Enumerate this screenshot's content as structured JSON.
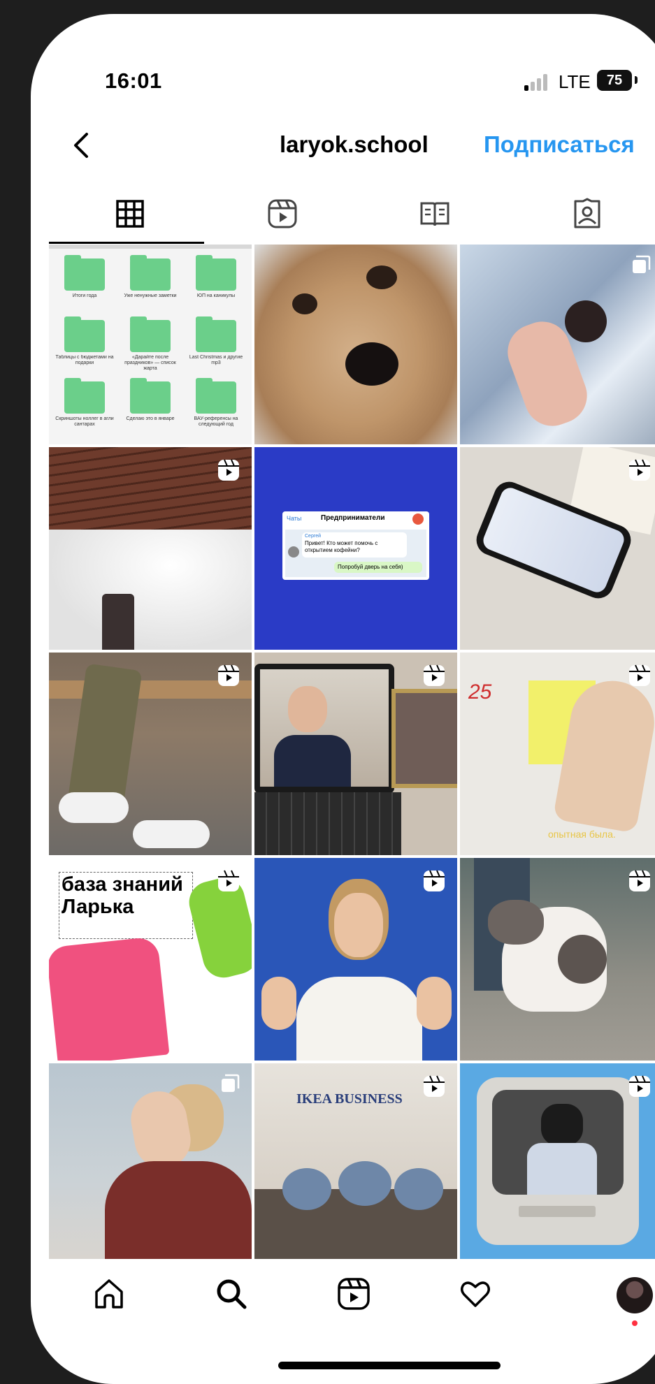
{
  "status_bar": {
    "time": "16:01",
    "network": "LTE",
    "battery": "75"
  },
  "header": {
    "username": "laryok.school",
    "follow_label": "Подписаться"
  },
  "tabs": [
    {
      "name": "grid",
      "icon": "grid-icon",
      "active": true
    },
    {
      "name": "reels",
      "icon": "reels-icon",
      "active": false
    },
    {
      "name": "guides",
      "icon": "guide-book-icon",
      "active": false
    },
    {
      "name": "tagged",
      "icon": "tagged-person-icon",
      "active": false
    }
  ],
  "posts": [
    {
      "id": 1,
      "badge": "none",
      "folders": [
        "Итоги года",
        "Уже ненужные заметки",
        "ЮП на каникулы",
        "Таблицы с бюджетами на подарки",
        "«Дарайте после праздников» — список жарта",
        "Last Christmas и другие mp3",
        "Скриншоты ноллег в агли сантарах",
        "Сделаю это в январе",
        "ВАУ-референсы на следующий год"
      ]
    },
    {
      "id": 2,
      "badge": "none"
    },
    {
      "id": 3,
      "badge": "multi"
    },
    {
      "id": 4,
      "badge": "reel"
    },
    {
      "id": 5,
      "badge": "none",
      "chat": {
        "back": "Чаты",
        "title": "Предприниматели",
        "sender": "Сергей",
        "message": "Привет! Кто может помочь с открытием кофейни?",
        "reply": "Попробуй дверь на себя)"
      }
    },
    {
      "id": 6,
      "badge": "reel"
    },
    {
      "id": 7,
      "badge": "reel"
    },
    {
      "id": 8,
      "badge": "reel"
    },
    {
      "id": 9,
      "badge": "reel",
      "caption": "опытная была.",
      "note_text": "25"
    },
    {
      "id": 10,
      "badge": "reel",
      "title": "база знаний Ларька"
    },
    {
      "id": 11,
      "badge": "reel"
    },
    {
      "id": 12,
      "badge": "reel"
    },
    {
      "id": 13,
      "badge": "multi"
    },
    {
      "id": 14,
      "badge": "reel",
      "sign": "IKEA BUSINESS"
    },
    {
      "id": 15,
      "badge": "reel"
    }
  ],
  "bottom_nav": [
    {
      "name": "home",
      "icon": "home-icon"
    },
    {
      "name": "search",
      "icon": "search-icon"
    },
    {
      "name": "reels",
      "icon": "reels-icon"
    },
    {
      "name": "activity",
      "icon": "heart-icon"
    },
    {
      "name": "profile",
      "icon": "avatar"
    }
  ],
  "colors": {
    "accent": "#2696f0",
    "chat_background": "#2a3bc6",
    "folder": "#6bcf8a"
  }
}
